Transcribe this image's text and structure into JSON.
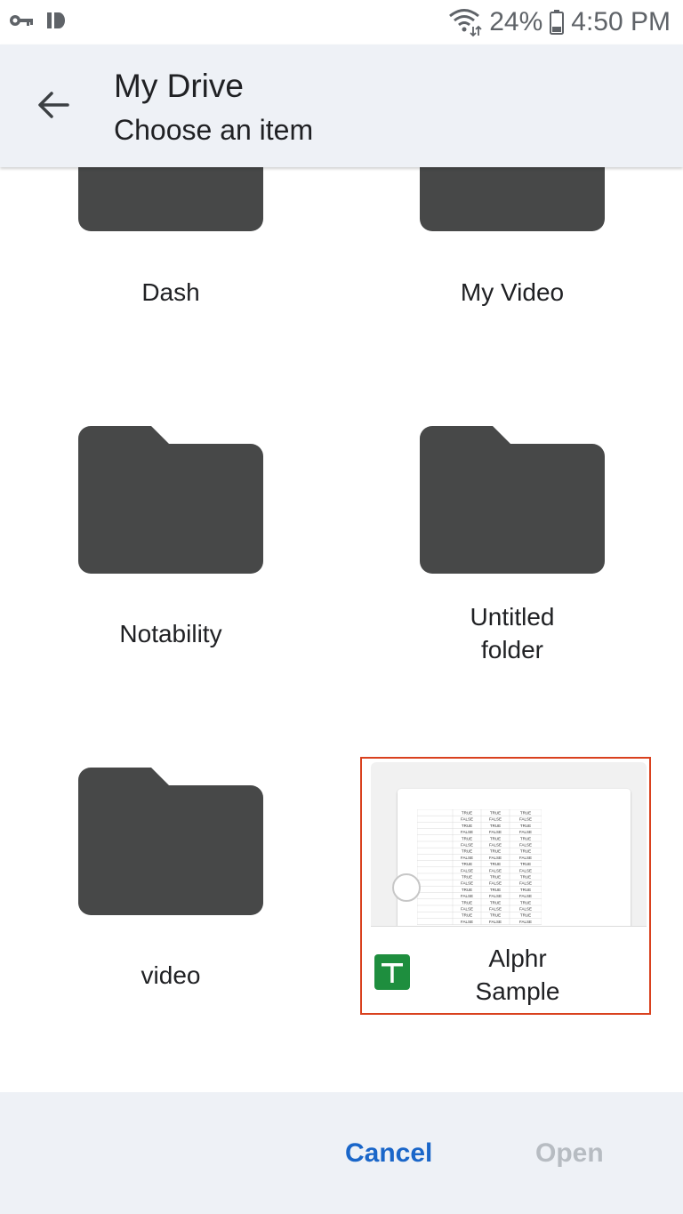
{
  "status_bar": {
    "left_icons": [
      "key-icon",
      "id-icon"
    ],
    "battery": "24%",
    "time": "4:50 PM"
  },
  "app_bar": {
    "title": "My Drive",
    "subtitle": "Choose an item",
    "back_icon": "arrow-back-icon"
  },
  "items": [
    {
      "name": "Dash",
      "type": "folder"
    },
    {
      "name": "My Video",
      "type": "folder"
    },
    {
      "name": "Notability",
      "type": "folder"
    },
    {
      "name": "Untitled folder",
      "type": "folder"
    },
    {
      "name": "video",
      "type": "folder"
    },
    {
      "name": "Alphr Sample",
      "type": "spreadsheet",
      "selected": true
    }
  ],
  "thumbnail_cells": [
    [
      "TRUE",
      "TRUE",
      "TRUE"
    ],
    [
      "FALSE",
      "FALSE",
      "FALSE"
    ],
    [
      "TRUE",
      "TRUE",
      "TRUE"
    ],
    [
      "FALSE",
      "FALSE",
      "FALSE"
    ],
    [
      "TRUE",
      "TRUE",
      "TRUE"
    ],
    [
      "FALSE",
      "FALSE",
      "FALSE"
    ],
    [
      "TRUE",
      "TRUE",
      "TRUE"
    ],
    [
      "FALSE",
      "FALSE",
      "FALSE"
    ],
    [
      "TRUE",
      "TRUE",
      "TRUE"
    ],
    [
      "FALSE",
      "FALSE",
      "FALSE"
    ],
    [
      "TRUE",
      "TRUE",
      "TRUE"
    ],
    [
      "FALSE",
      "FALSE",
      "FALSE"
    ],
    [
      "TRUE",
      "TRUE",
      "TRUE"
    ],
    [
      "FALSE",
      "FALSE",
      "FALSE"
    ],
    [
      "TRUE",
      "TRUE",
      "TRUE"
    ],
    [
      "FALSE",
      "FALSE",
      "FALSE"
    ],
    [
      "TRUE",
      "TRUE",
      "TRUE"
    ],
    [
      "FALSE",
      "FALSE",
      "FALSE"
    ]
  ],
  "footer": {
    "cancel_label": "Cancel",
    "open_label": "Open"
  },
  "colors": {
    "folder": "#474848",
    "accent": "#1a66c9",
    "disabled": "#b7bcc2",
    "selection_border": "#d9411e",
    "sheets_green": "#1e8e3e",
    "app_bar_bg": "#eef1f6"
  }
}
